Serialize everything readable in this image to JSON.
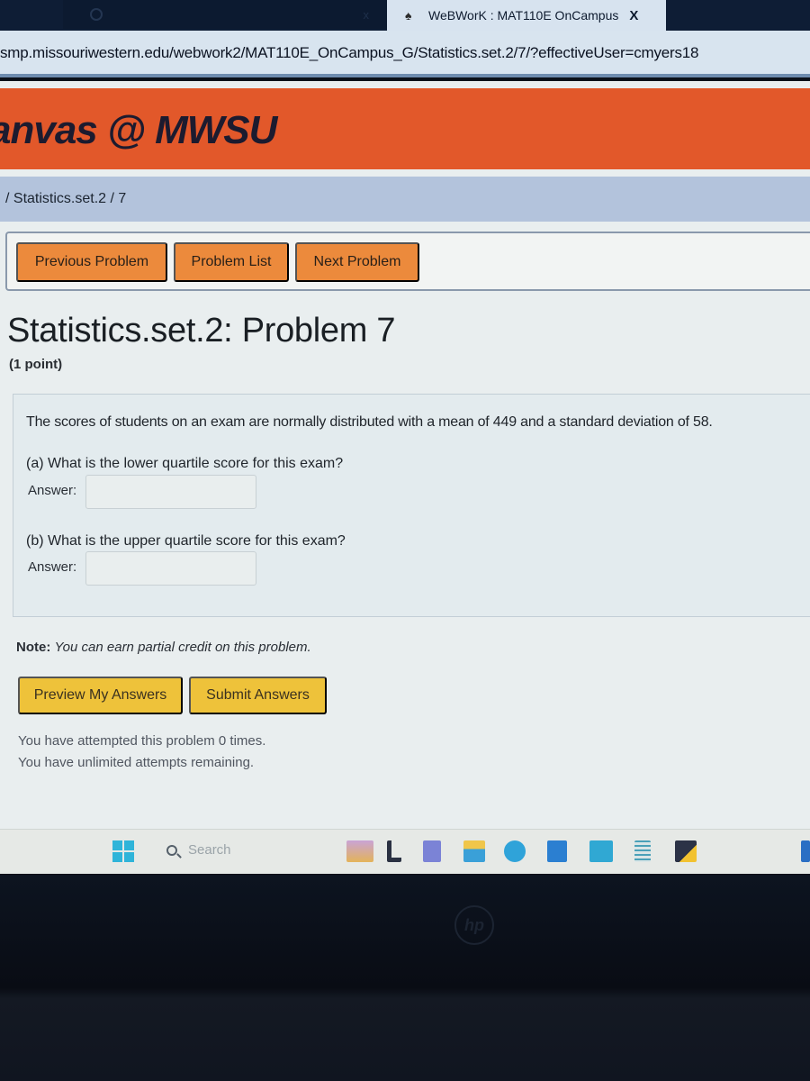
{
  "browser": {
    "inactive_tab": {
      "title": "",
      "close": "x"
    },
    "active_tab": {
      "title": "WeBWorK : MAT110E OnCampus",
      "close": "X"
    },
    "url": "smp.missouriwestern.edu/webwork2/MAT110E_OnCampus_G/Statistics.set.2/7/?effectiveUser=cmyers18"
  },
  "header": {
    "brand": "anvas @ MWSU",
    "brand_color": "#e2582a"
  },
  "breadcrumb": {
    "text": "/ Statistics.set.2 / 7"
  },
  "nav": {
    "previous": "Previous Problem",
    "list": "Problem List",
    "next": "Next Problem"
  },
  "problem": {
    "title": "Statistics.set.2: Problem 7",
    "points": "(1 point)",
    "statement": "The scores of students on an exam are normally distributed with a mean of 449 and a standard deviation of 58.",
    "parts": [
      {
        "question": "(a) What is the lower quartile score for this exam?",
        "answer_label": "Answer:",
        "answer_value": ""
      },
      {
        "question": "(b) What is the upper quartile score for this exam?",
        "answer_label": "Answer:",
        "answer_value": ""
      }
    ],
    "note_label": "Note:",
    "note_text": "You can earn partial credit on this problem."
  },
  "actions": {
    "preview": "Preview My Answers",
    "submit": "Submit Answers"
  },
  "attempts": {
    "line1": "You have attempted this problem 0 times.",
    "line2": "You have unlimited attempts remaining."
  },
  "taskbar": {
    "search_placeholder": "Search",
    "icons": [
      "windows-start",
      "paint",
      "taskbar-app",
      "teams",
      "file-explorer",
      "edge",
      "microsoft-store",
      "myhp",
      "notepad",
      "sticky-notes",
      "outlook"
    ]
  },
  "device": {
    "logo": "hp"
  }
}
